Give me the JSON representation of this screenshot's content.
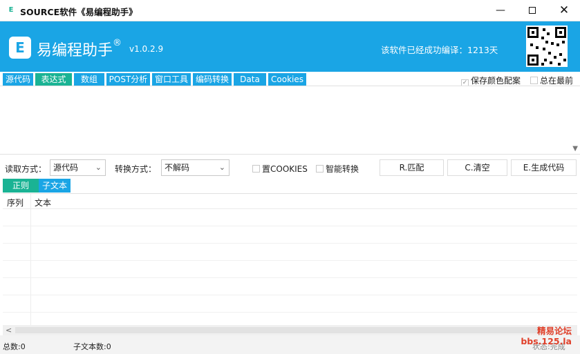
{
  "window": {
    "app_icon": "E",
    "title": "SOURCE软件《易编程助手》",
    "min_glyph": "—",
    "close_glyph": "✕"
  },
  "banner": {
    "logo_letter": "E",
    "brand": "易编程助手",
    "registered": "®",
    "version": "v1.0.2.9",
    "info": "该软件已经成功编译：1213天"
  },
  "tabs": [
    "源代码",
    "表达式",
    "数组",
    "POST分析",
    "窗口工具",
    "编码转换",
    "Data",
    "Cookies"
  ],
  "active_tab_index": 1,
  "checkboxes": {
    "save_color": {
      "label": "保存颜色配案",
      "checked": true
    },
    "always_top": {
      "label": "总在最前",
      "checked": false
    }
  },
  "options": {
    "read_mode_label": "读取方式：",
    "read_mode_value": "源代码",
    "convert_mode_label": "转换方式：",
    "convert_mode_value": "不解码",
    "cookies_label": "置COOKIES",
    "smart_convert_label": "智能转换",
    "match_button": "R.匹配",
    "clear_button": "C.清空",
    "gen_code_button": "E.生成代码"
  },
  "subtabs": [
    "正则",
    "子文本"
  ],
  "table": {
    "columns": [
      "序列",
      "文本"
    ],
    "rows": []
  },
  "status": {
    "total": "总数:0",
    "subtext_count": "子文本数:0",
    "state": "状态:完成"
  },
  "watermark": {
    "line1": "精易论坛",
    "line2": "bbs.125.la"
  },
  "colors": {
    "accent_blue": "#1aa5e5",
    "accent_green": "#1ab394"
  }
}
